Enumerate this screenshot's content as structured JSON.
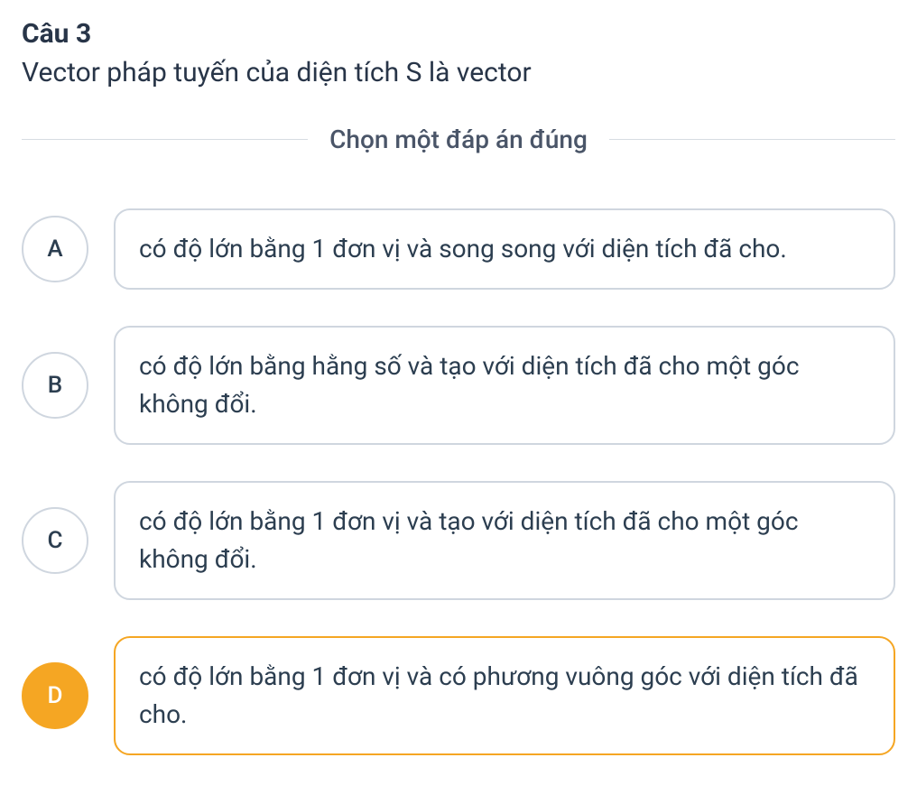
{
  "question": {
    "number_label": "Câu 3",
    "text": "Vector pháp tuyến của diện tích S là vector"
  },
  "instruction": "Chọn một đáp án đúng",
  "options": [
    {
      "letter": "A",
      "text": "có độ lớn bằng 1 đơn vị và song song với diện tích đã cho.",
      "selected": false
    },
    {
      "letter": "B",
      "text": "có độ lớn bằng hằng số và tạo với diện tích đã cho một góc không đổi.",
      "selected": false
    },
    {
      "letter": "C",
      "text": "có độ lớn bằng 1 đơn vị và tạo với diện tích đã cho một góc không đổi.",
      "selected": false
    },
    {
      "letter": "D",
      "text": "có độ lớn bằng 1 đơn vị và có phương vuông góc với diện tích đã cho.",
      "selected": true
    }
  ]
}
